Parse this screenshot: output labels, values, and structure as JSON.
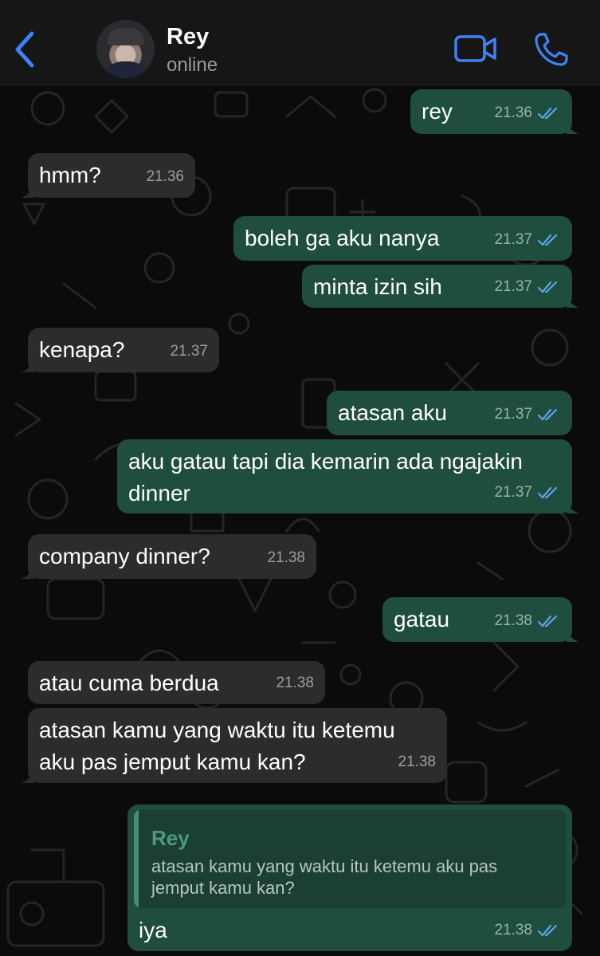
{
  "header": {
    "contact_name": "Rey",
    "contact_status": "online",
    "back_icon": "chevron-left-icon",
    "video_icon": "video-camera-icon",
    "call_icon": "phone-icon"
  },
  "colors": {
    "accent": "#3e82f7",
    "incoming_bubble": "#2c2c2e",
    "outgoing_bubble": "#1f4d3e",
    "read_ticks": "#5aa6e8"
  },
  "messages": [
    {
      "direction": "out",
      "text": "rey",
      "time": "21.36",
      "read": true
    },
    {
      "direction": "in",
      "text": "hmm?",
      "time": "21.36"
    },
    {
      "direction": "out",
      "text": "boleh ga aku nanya",
      "time": "21.37",
      "read": true
    },
    {
      "direction": "out",
      "text": "minta izin sih",
      "time": "21.37",
      "read": true
    },
    {
      "direction": "in",
      "text": "kenapa?",
      "time": "21.37"
    },
    {
      "direction": "out",
      "text": "atasan aku",
      "time": "21.37",
      "read": true
    },
    {
      "direction": "out",
      "text": "aku gatau tapi dia kemarin ada ngajakin dinner",
      "time": "21.37",
      "read": true
    },
    {
      "direction": "in",
      "text": "company dinner?",
      "time": "21.38"
    },
    {
      "direction": "out",
      "text": "gatau",
      "time": "21.38",
      "read": true
    },
    {
      "direction": "in",
      "text": "atau cuma berdua",
      "time": "21.38"
    },
    {
      "direction": "in",
      "text": "atasan kamu yang waktu itu ketemu aku pas jemput kamu kan?",
      "time": "21.38"
    },
    {
      "direction": "out",
      "text": "iya",
      "time": "21.38",
      "read": true,
      "reply_to": {
        "name": "Rey",
        "text": "atasan kamu yang waktu itu ketemu aku pas jemput kamu kan?"
      }
    }
  ]
}
